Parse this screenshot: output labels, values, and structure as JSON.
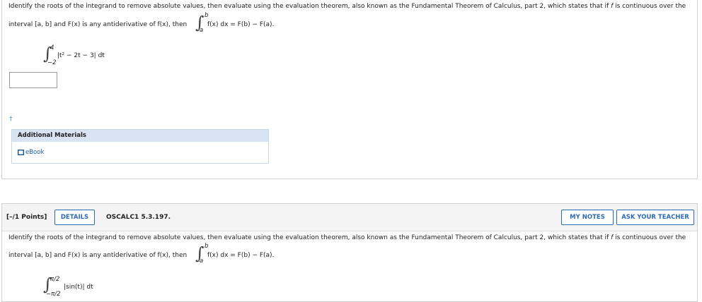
{
  "q1": {
    "line1": "Identify the roots of the integrand to remove absolute values, then evaluate using the evaluation theorem, also known as the Fundamental Theorem of Calculus, part 2, which states that if ",
    "line1_f": "f",
    "line1_end": " is continuous over the",
    "line2": "interval [a, b] and F(x) is any antiderivative of f(x), then",
    "ftc_integrand": "f(x) dx = F(b) − F(a).",
    "ftc_upper": "b",
    "ftc_lower": "a",
    "problem_upper": "4",
    "problem_lower": "−2",
    "problem_integrand": "|t² − 2t − 3| dt",
    "answer_value": "",
    "dagger": "†",
    "additional_materials": "Additional Materials",
    "ebook": "eBook"
  },
  "q2": {
    "points": "[–/1 Points]",
    "details_button": "DETAILS",
    "code": "OSCALC1 5.3.197.",
    "my_notes_button": "MY NOTES",
    "ask_teacher_button": "ASK YOUR TEACHER",
    "line1": "Identify the roots of the integrand to remove absolute values, then evaluate using the evaluation theorem, also known as the Fundamental Theorem of Calculus, part 2, which states that if ",
    "line1_f": "f",
    "line1_end": " is continuous over the",
    "line2": "interval [a, b] and F(x) is any antiderivative of f(x), then",
    "ftc_integrand": "f(x) dx = F(b) − F(a).",
    "ftc_upper": "b",
    "ftc_lower": "a",
    "problem_upper": "π/2",
    "problem_lower": "−π/2",
    "problem_integrand": "|sin(t)| dt"
  },
  "colors": {
    "accent": "#2e6bb3",
    "header_bg": "#f4f4f4",
    "materials_head": "#d8e3f3"
  },
  "icons": {
    "ebook": "book-icon"
  }
}
